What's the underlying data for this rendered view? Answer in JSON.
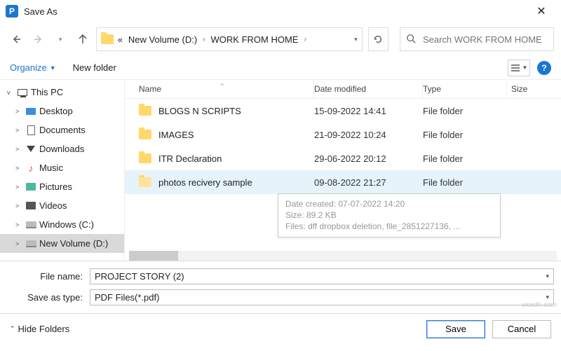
{
  "title": "Save As",
  "breadcrumbs": {
    "pre": "«",
    "a": "New Volume (D:)",
    "b": "WORK FROM HOME"
  },
  "search": {
    "placeholder": "Search WORK FROM HOME"
  },
  "toolbar": {
    "organize": "Organize",
    "new_folder": "New folder"
  },
  "columns": {
    "name": "Name",
    "date": "Date modified",
    "type": "Type",
    "size": "Size"
  },
  "sidebar": {
    "items": [
      {
        "label": "This PC",
        "exp": "v"
      },
      {
        "label": "Desktop",
        "exp": ">"
      },
      {
        "label": "Documents",
        "exp": ">"
      },
      {
        "label": "Downloads",
        "exp": ">"
      },
      {
        "label": "Music",
        "exp": ">"
      },
      {
        "label": "Pictures",
        "exp": ">"
      },
      {
        "label": "Videos",
        "exp": ">"
      },
      {
        "label": "Windows (C:)",
        "exp": ">"
      },
      {
        "label": "New Volume (D:)",
        "exp": ">"
      }
    ]
  },
  "files": [
    {
      "name": "BLOGS N SCRIPTS",
      "date": "15-09-2022 14:41",
      "type": "File folder"
    },
    {
      "name": "IMAGES",
      "date": "21-09-2022 10:24",
      "type": "File folder"
    },
    {
      "name": "ITR Declaration",
      "date": "29-06-2022 20:12",
      "type": "File folder"
    },
    {
      "name": "photos recivery sample",
      "date": "09-08-2022 21:27",
      "type": "File folder"
    }
  ],
  "tooltip": {
    "l1": "Date created: 07-07-2022 14:20",
    "l2": "Size: 89.2 KB",
    "l3": "Files: dff dropbox deletion, file_2851227136, ..."
  },
  "fields": {
    "filename_label": "File name:",
    "filename_value": "PROJECT STORY (2)",
    "saveas_label": "Save as type:",
    "saveas_value": "PDF Files(*.pdf)"
  },
  "footer": {
    "hide": "Hide Folders",
    "save": "Save",
    "cancel": "Cancel"
  },
  "watermark": "wsxdn.com"
}
